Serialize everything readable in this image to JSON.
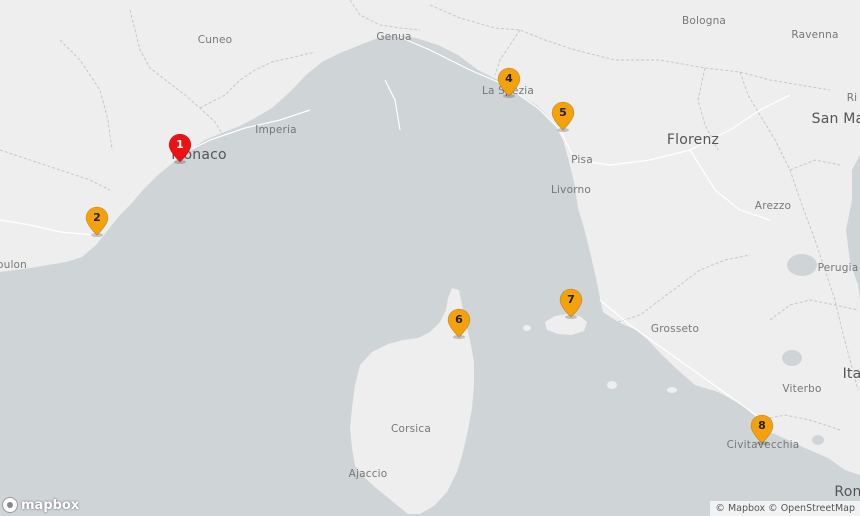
{
  "cities": [
    {
      "name": "Cuneo",
      "big": false
    },
    {
      "name": "Genua",
      "big": false
    },
    {
      "name": "Bologna",
      "big": false
    },
    {
      "name": "Ravenna",
      "big": false
    },
    {
      "name": "Imperia",
      "big": false
    },
    {
      "name": "Monaco",
      "big": true
    },
    {
      "name": "La Spezia",
      "big": false
    },
    {
      "name": "Florenz",
      "big": true
    },
    {
      "name": "San Ma",
      "big": true
    },
    {
      "name": "Pisa",
      "big": false
    },
    {
      "name": "Livorno",
      "big": false
    },
    {
      "name": "Arezzo",
      "big": false
    },
    {
      "name": "Perugia",
      "big": false
    },
    {
      "name": "oulon",
      "big": false
    },
    {
      "name": "Grosseto",
      "big": false
    },
    {
      "name": "Viterbo",
      "big": false
    },
    {
      "name": "Ita",
      "big": true
    },
    {
      "name": "Corsica",
      "big": false
    },
    {
      "name": "Ajaccio",
      "big": false
    },
    {
      "name": "Civitavecchia",
      "big": false
    },
    {
      "name": "Ron",
      "big": true
    },
    {
      "name": "Ri",
      "big": false
    }
  ],
  "markers": [
    {
      "label": "1",
      "color": "#ee1111"
    },
    {
      "label": "2",
      "color": "#f5a20a"
    },
    {
      "label": "4",
      "color": "#f5a20a"
    },
    {
      "label": "5",
      "color": "#f5a20a"
    },
    {
      "label": "6",
      "color": "#f5a20a"
    },
    {
      "label": "7",
      "color": "#f5a20a"
    },
    {
      "label": "8",
      "color": "#f5a20a"
    }
  ],
  "logo": {
    "text": "mapbox"
  },
  "attribution": {
    "text": "© Mapbox © OpenStreetMap"
  },
  "colors": {
    "sea": "#cfd4d7",
    "land": "#eeeeee",
    "border": "#c7c7c7"
  }
}
